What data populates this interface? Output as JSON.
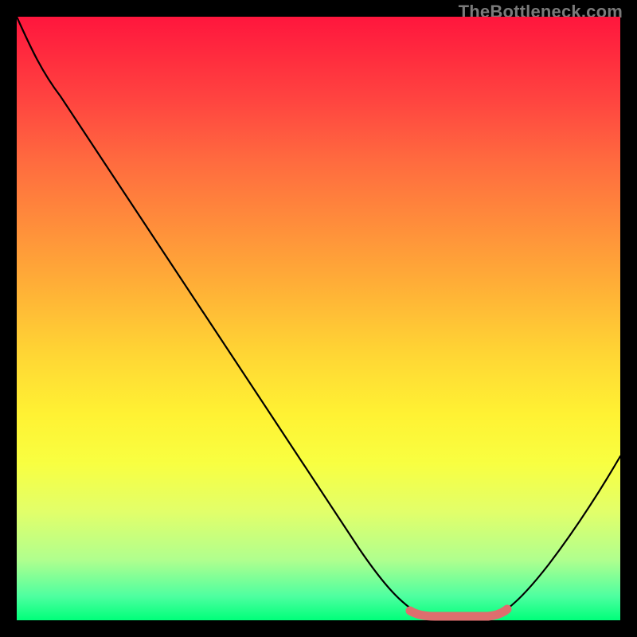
{
  "watermark": "TheBottleneck.com",
  "chart_data": {
    "type": "line",
    "title": "",
    "xlabel": "",
    "ylabel": "",
    "x": [
      0,
      3,
      8,
      14,
      22,
      30,
      38,
      46,
      54,
      60,
      64,
      67,
      70,
      74,
      78,
      80,
      84,
      88,
      92,
      96,
      100
    ],
    "values": [
      100,
      94,
      86,
      77,
      65,
      53,
      41,
      30,
      18,
      9,
      3,
      1,
      0,
      0,
      0,
      1,
      4,
      9,
      15,
      22,
      30
    ],
    "xlim": [
      0,
      100
    ],
    "ylim": [
      0,
      100
    ],
    "annotations": [
      {
        "label": "bottom-plateau",
        "x_range": [
          67,
          80
        ],
        "y": 0
      }
    ],
    "colors": {
      "curve": "#000000",
      "plateau_marker": "#e07070",
      "gradient_top": "#ff163d",
      "gradient_bottom": "#00ff7a",
      "frame": "#000000"
    },
    "notes": "No axis ticks or numeric labels are rendered in the original; values are visual estimates on a 0–100 scale in both directions. The curve resembles a bottleneck/V profile with a flat zero region roughly 67–80% across, highlighted by a thick muted-red stroke."
  }
}
